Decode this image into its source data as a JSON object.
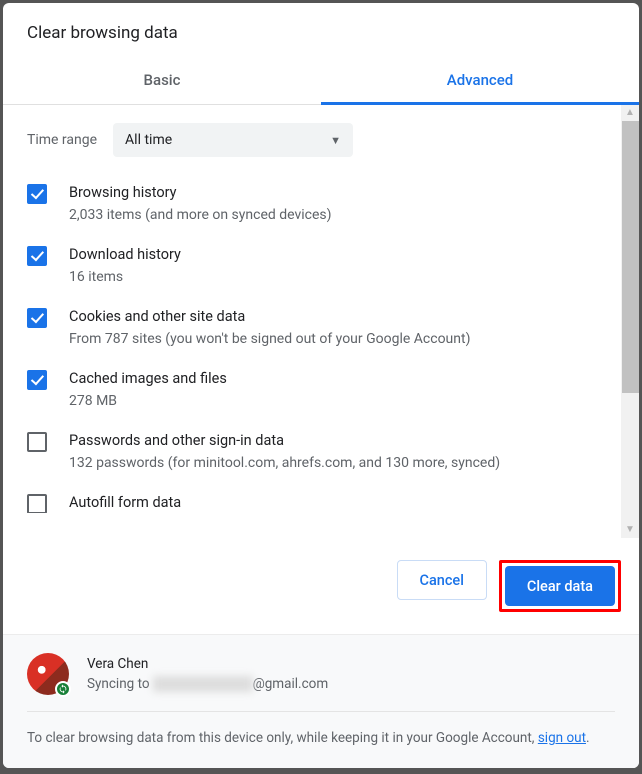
{
  "title": "Clear browsing data",
  "tabs": {
    "basic": "Basic",
    "advanced": "Advanced"
  },
  "timeRange": {
    "label": "Time range",
    "value": "All time"
  },
  "items": [
    {
      "checked": true,
      "title": "Browsing history",
      "sub": "2,033 items (and more on synced devices)"
    },
    {
      "checked": true,
      "title": "Download history",
      "sub": "16 items"
    },
    {
      "checked": true,
      "title": "Cookies and other site data",
      "sub": "From 787 sites (you won't be signed out of your Google Account)"
    },
    {
      "checked": true,
      "title": "Cached images and files",
      "sub": "278 MB"
    },
    {
      "checked": false,
      "title": "Passwords and other sign-in data",
      "sub": "132 passwords (for minitool.com, ahrefs.com, and 130 more, synced)"
    },
    {
      "checked": false,
      "title": "Autofill form data",
      "sub": ""
    }
  ],
  "actions": {
    "cancel": "Cancel",
    "clear": "Clear data"
  },
  "sync": {
    "name": "Vera Chen",
    "prefix": "Syncing to ",
    "emailHidden": "██████████",
    "emailSuffix": "@gmail.com"
  },
  "footer": {
    "text1": "To clear browsing data from this device only, while keeping it in your Google Account, ",
    "link": "sign out",
    "text2": "."
  }
}
